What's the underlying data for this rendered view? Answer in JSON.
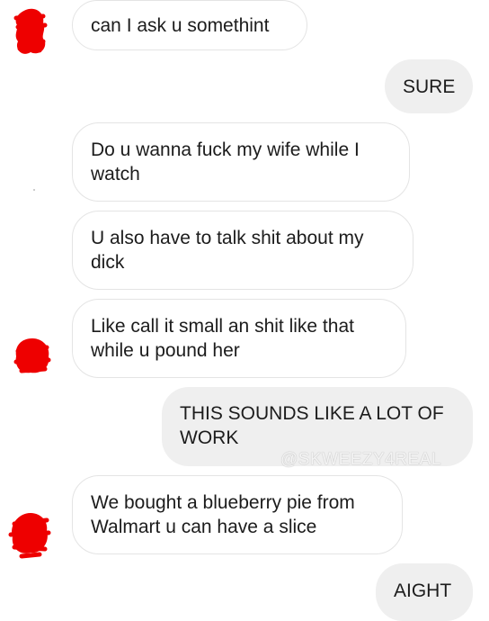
{
  "conversation": {
    "messages": [
      {
        "sender": "them",
        "text": "can I ask u somethint"
      },
      {
        "sender": "me",
        "text": "SURE"
      },
      {
        "sender": "them",
        "text": "Do u wanna fuck my wife while I\nwatch"
      },
      {
        "sender": "them",
        "text": "U also have to talk shit about my\ndick"
      },
      {
        "sender": "them",
        "text": "Like call it small an shit like that\nwhile u pound her"
      },
      {
        "sender": "me",
        "text": "THIS SOUNDS LIKE A LOT OF\nWORK"
      },
      {
        "sender": "them",
        "text": "We bought a blueberry pie from\nWalmart u can have a slice"
      },
      {
        "sender": "me",
        "text": "AIGHT"
      }
    ]
  },
  "watermark": "@SKWEEZY4REAL",
  "colors": {
    "redaction": "#ee0000",
    "outgoing_bubble": "#efefef",
    "incoming_border": "#e4e4e4",
    "text": "#1c1c1c"
  },
  "icons": {
    "avatar": "redacted-avatar-icon"
  }
}
